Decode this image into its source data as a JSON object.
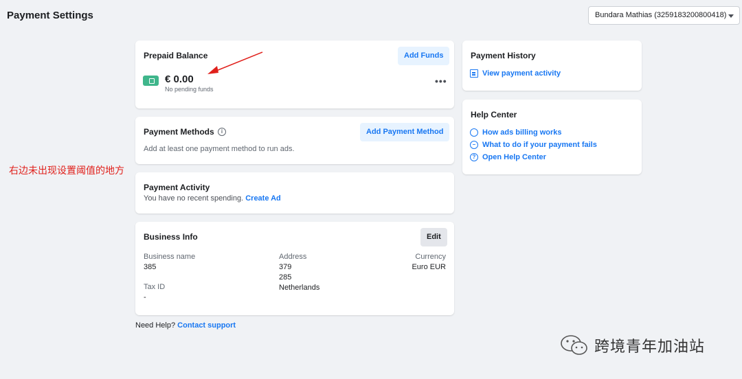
{
  "header": {
    "title": "Payment Settings"
  },
  "account_selector": {
    "value": "Bundara Mathias (3259183200800418)"
  },
  "prepaid": {
    "title": "Prepaid Balance",
    "add_funds_label": "Add Funds",
    "amount": "€ 0.00",
    "pending": "No pending funds",
    "more_label": "•••"
  },
  "methods": {
    "title": "Payment Methods",
    "info_glyph": "i",
    "add_label": "Add Payment Method",
    "description": "Add at least one payment method to run ads."
  },
  "activity": {
    "title": "Payment Activity",
    "description": "You have no recent spending.",
    "create_ad_label": "Create Ad"
  },
  "business": {
    "title": "Business Info",
    "edit_label": "Edit",
    "name_label": "Business name",
    "name_value": "385",
    "address_label": "Address",
    "address_lines": [
      "379",
      "285",
      "Netherlands"
    ],
    "currency_label": "Currency",
    "currency_value": "Euro EUR",
    "tax_label": "Tax ID",
    "tax_value": "-"
  },
  "footer_help": {
    "prefix": "Need Help?",
    "link": "Contact support"
  },
  "history": {
    "title": "Payment History",
    "link": "View payment activity"
  },
  "help_center": {
    "title": "Help Center",
    "links": [
      "How ads billing works",
      "What to do if your payment fails",
      "Open Help Center"
    ]
  },
  "annotation": {
    "text": "右边未出现设置阈值的地方",
    "color": "#e0201b"
  },
  "watermark": {
    "text": "跨境青年加油站"
  },
  "colors": {
    "accent": "#1877f2",
    "wallet": "#3fb68b",
    "background": "#f0f2f5"
  }
}
